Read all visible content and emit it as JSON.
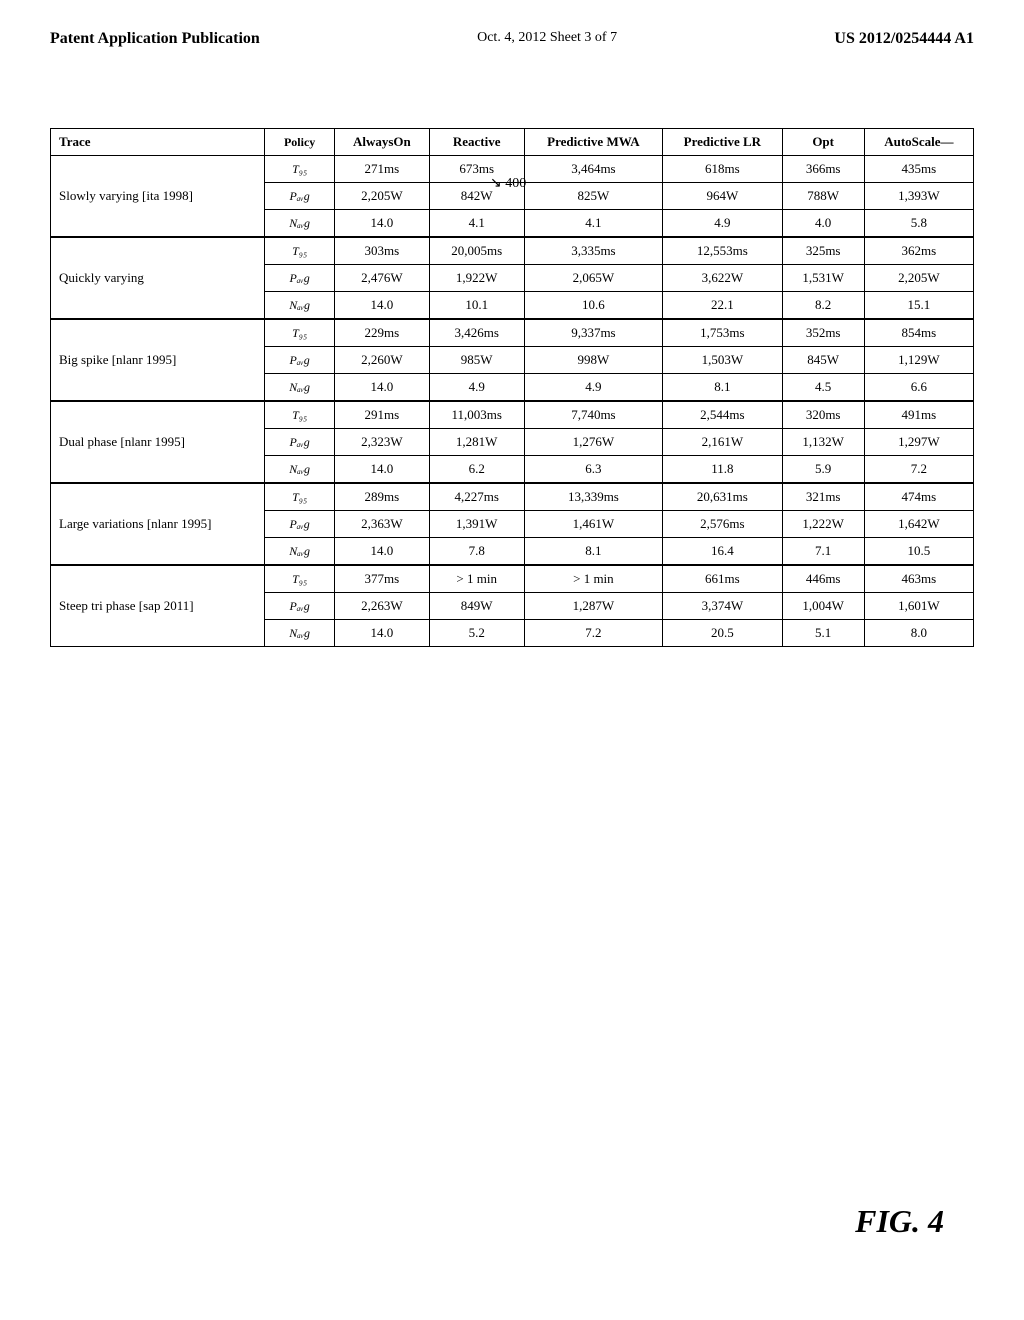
{
  "header": {
    "left": "Patent Application Publication",
    "center": "Oct. 4, 2012   Sheet 3 of 7",
    "right": "US 2012/0254444 A1"
  },
  "arrow_label": "400",
  "fig_label": "FIG. 4",
  "table": {
    "columns": [
      "Trace",
      "Policy",
      "AlwaysOn",
      "Reactive",
      "Predictive MWA",
      "Predictive LR",
      "Opt",
      "AutoScale--"
    ],
    "groups": [
      {
        "trace": "Slowly varying [ita 1998]",
        "rows": [
          {
            "policy": "T₉₅",
            "alwayson": "271ms",
            "reactive": "673ms",
            "pred_mwa": "3,464ms",
            "pred_lr": "618ms",
            "opt": "366ms",
            "autoscale": "435ms"
          },
          {
            "policy": "Pₐᵥg",
            "alwayson": "2,205W",
            "reactive": "842W",
            "pred_mwa": "825W",
            "pred_lr": "964W",
            "opt": "788W",
            "autoscale": "1,393W"
          },
          {
            "policy": "Nₐᵥg",
            "alwayson": "14.0",
            "reactive": "4.1",
            "pred_mwa": "4.1",
            "pred_lr": "4.9",
            "opt": "4.0",
            "autoscale": "5.8"
          }
        ]
      },
      {
        "trace": "Quickly varying",
        "rows": [
          {
            "policy": "T₉₅",
            "alwayson": "303ms",
            "reactive": "20,005ms",
            "pred_mwa": "3,335ms",
            "pred_lr": "12,553ms",
            "opt": "325ms",
            "autoscale": "362ms"
          },
          {
            "policy": "Pₐᵥg",
            "alwayson": "2,476W",
            "reactive": "1,922W",
            "pred_mwa": "2,065W",
            "pred_lr": "3,622W",
            "opt": "1,531W",
            "autoscale": "2,205W"
          },
          {
            "policy": "Nₐᵥg",
            "alwayson": "14.0",
            "reactive": "10.1",
            "pred_mwa": "10.6",
            "pred_lr": "22.1",
            "opt": "8.2",
            "autoscale": "15.1"
          }
        ]
      },
      {
        "trace": "Big spike [nlanr 1995]",
        "rows": [
          {
            "policy": "T₉₅",
            "alwayson": "229ms",
            "reactive": "3,426ms",
            "pred_mwa": "9,337ms",
            "pred_lr": "1,753ms",
            "opt": "352ms",
            "autoscale": "854ms"
          },
          {
            "policy": "Pₐᵥg",
            "alwayson": "2,260W",
            "reactive": "985W",
            "pred_mwa": "998W",
            "pred_lr": "1,503W",
            "opt": "845W",
            "autoscale": "1,129W"
          },
          {
            "policy": "Nₐᵥg",
            "alwayson": "14.0",
            "reactive": "4.9",
            "pred_mwa": "4.9",
            "pred_lr": "8.1",
            "opt": "4.5",
            "autoscale": "6.6"
          }
        ]
      },
      {
        "trace": "Dual phase [nlanr 1995]",
        "rows": [
          {
            "policy": "T₉₅",
            "alwayson": "291ms",
            "reactive": "11,003ms",
            "pred_mwa": "7,740ms",
            "pred_lr": "2,544ms",
            "opt": "320ms",
            "autoscale": "491ms"
          },
          {
            "policy": "Pₐᵥg",
            "alwayson": "2,323W",
            "reactive": "1,281W",
            "pred_mwa": "1,276W",
            "pred_lr": "2,161W",
            "opt": "1,132W",
            "autoscale": "1,297W"
          },
          {
            "policy": "Nₐᵥg",
            "alwayson": "14.0",
            "reactive": "6.2",
            "pred_mwa": "6.3",
            "pred_lr": "11.8",
            "opt": "5.9",
            "autoscale": "7.2"
          }
        ]
      },
      {
        "trace": "Large variations [nlanr 1995]",
        "rows": [
          {
            "policy": "T₉₅",
            "alwayson": "289ms",
            "reactive": "4,227ms",
            "pred_mwa": "13,339ms",
            "pred_lr": "20,631ms",
            "opt": "321ms",
            "autoscale": "474ms"
          },
          {
            "policy": "Pₐᵥg",
            "alwayson": "2,363W",
            "reactive": "1,391W",
            "pred_mwa": "1,461W",
            "pred_lr": "2,576ms",
            "opt": "1,222W",
            "autoscale": "1,642W"
          },
          {
            "policy": "Nₐᵥg",
            "alwayson": "14.0",
            "reactive": "7.8",
            "pred_mwa": "8.1",
            "pred_lr": "16.4",
            "opt": "7.1",
            "autoscale": "10.5"
          }
        ]
      },
      {
        "trace": "Steep tri phase [sap 2011]",
        "rows": [
          {
            "policy": "T₉₅",
            "alwayson": "377ms",
            "reactive": "> 1 min",
            "pred_mwa": "> 1 min",
            "pred_lr": "661ms",
            "opt": "446ms",
            "autoscale": "463ms"
          },
          {
            "policy": "Pₐᵥg",
            "alwayson": "2,263W",
            "reactive": "849W",
            "pred_mwa": "1,287W",
            "pred_lr": "3,374W",
            "opt": "1,004W",
            "autoscale": "1,601W"
          },
          {
            "policy": "Nₐᵥg",
            "alwayson": "14.0",
            "reactive": "5.2",
            "pred_mwa": "7.2",
            "pred_lr": "20.5",
            "opt": "5.1",
            "autoscale": "8.0"
          }
        ]
      }
    ]
  }
}
